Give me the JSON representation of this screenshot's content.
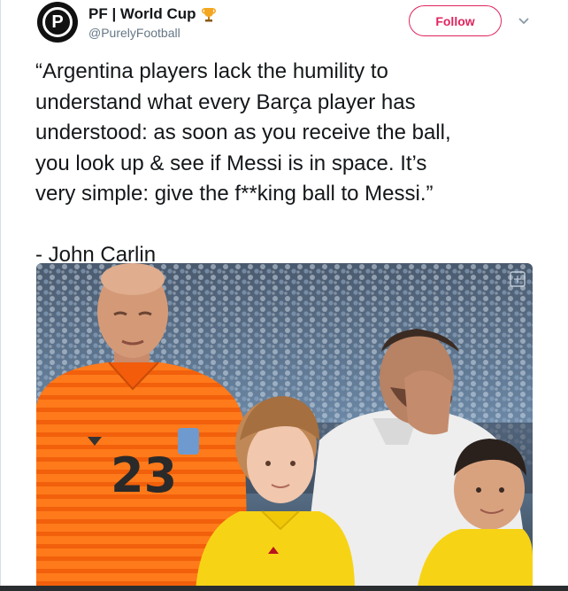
{
  "header": {
    "display_name": "PF | World Cup",
    "handle": "@PurelyFootball",
    "avatar_letter": "P",
    "follow_label": "Follow"
  },
  "tweet": {
    "line1": "“Argentina players lack the humility to",
    "line2": "understand what every Barça player has",
    "line3": "understood: as soon as you receive the ball,",
    "line4": "you look up & see if Messi is in space. It’s",
    "line5": "very simple: give the f**king ball to Messi.”",
    "attribution": "- John Carlin"
  },
  "media": {
    "jersey_number": "23"
  },
  "colors": {
    "follow_accent": "#e0245e",
    "handle_gray": "#657786",
    "text": "#14171a",
    "keeper_kit": "#ff7a1a",
    "mascot_kit": "#f7d316"
  },
  "icons": {
    "avatar": "avatar-p-logo",
    "trophy": "trophy-icon",
    "caret": "chevron-down-icon",
    "expand": "expand-icon"
  }
}
